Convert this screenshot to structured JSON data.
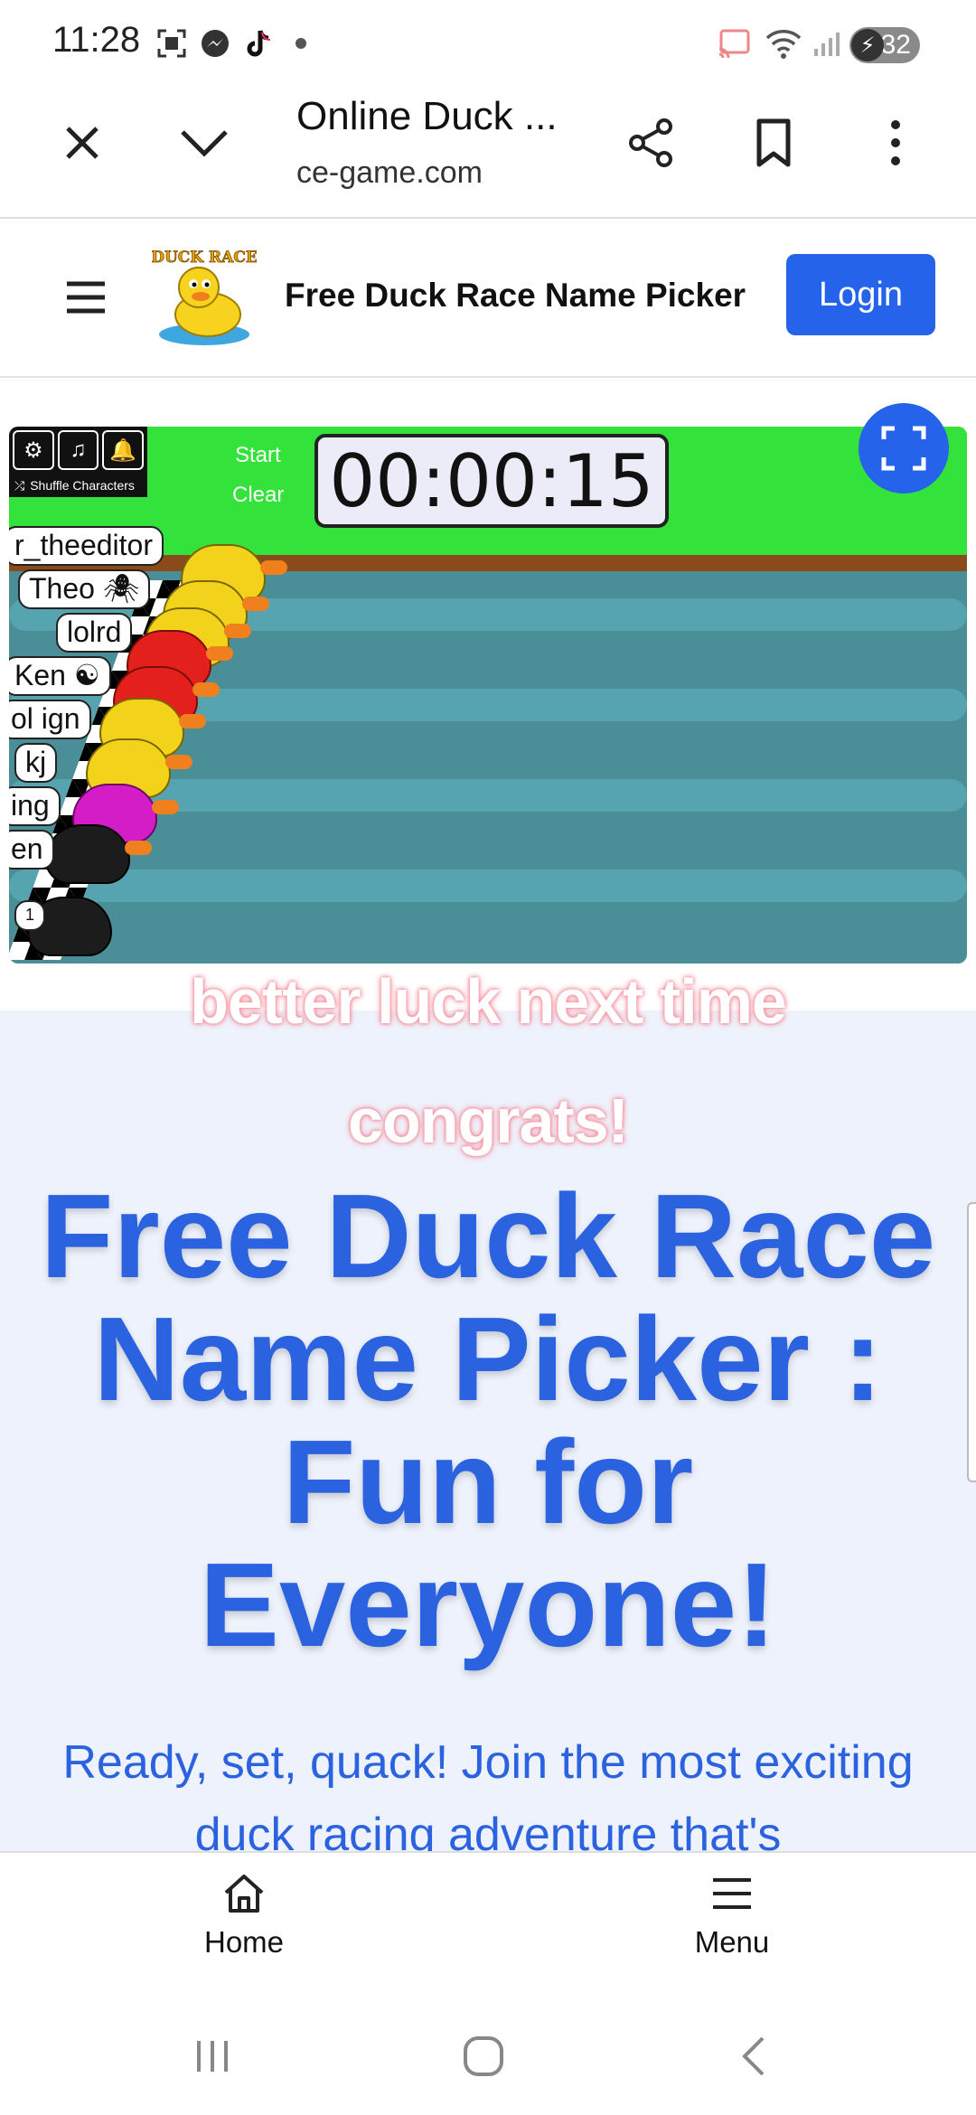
{
  "status_bar": {
    "time": "11:28",
    "left_icons": [
      "screenshot-icon",
      "messenger-icon",
      "tiktok-icon",
      "dot-icon"
    ],
    "right_icons": [
      "cast-icon",
      "wifi-icon",
      "signal-icon"
    ],
    "battery": "32"
  },
  "browser": {
    "tab_title": "Online Duck ...",
    "url": "ce-game.com"
  },
  "site_header": {
    "title": "Free Duck Race Name Picker",
    "login_label": "Login",
    "logo_text": "DUCK RACE"
  },
  "game": {
    "start_label": "Start",
    "clear_label": "Clear",
    "shuffle_label": "Shuffle Characters",
    "timer": "00:00:15",
    "racers": [
      "r_theeditor",
      "Theo 🕷",
      "lolrd",
      "Ken ☯",
      "ol ign",
      "kj",
      "ing",
      "en"
    ],
    "lane_badge": "1"
  },
  "overlays": {
    "line1": "better luck next time",
    "line2": "congrats!"
  },
  "hero": {
    "title": "Free Duck Race Name Picker : Fun for Everyone!",
    "subtitle": "Ready, set, quack! Join the most exciting duck racing adventure that's"
  },
  "bottom_nav": {
    "home_label": "Home",
    "menu_label": "Menu"
  },
  "colors": {
    "accent": "#2563eb",
    "hero_text": "#2a62e0",
    "grass": "#33e23a",
    "water": "#4a8e98"
  }
}
